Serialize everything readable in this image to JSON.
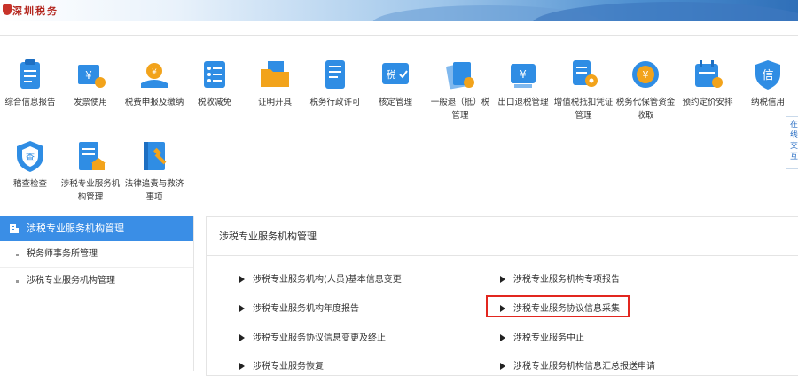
{
  "banner": {
    "logo_text": "深圳税务"
  },
  "tiles": [
    {
      "label": "综合信息报告",
      "icon": "report-icon",
      "color": "#2f8de4"
    },
    {
      "label": "发票使用",
      "icon": "invoice-icon",
      "color": "#2f8de4"
    },
    {
      "label": "税费申报及缴纳",
      "icon": "tax-declare-icon",
      "color": "#2f8de4"
    },
    {
      "label": "税收减免",
      "icon": "tax-relief-icon",
      "color": "#2f8de4"
    },
    {
      "label": "证明开具",
      "icon": "certificate-folder-icon",
      "color": "#f2a31b"
    },
    {
      "label": "税务行政许可",
      "icon": "license-doc-icon",
      "color": "#2f8de4"
    },
    {
      "label": "核定管理",
      "icon": "tax-check-icon",
      "color": "#2f8de4"
    },
    {
      "label": "一般退（抵）税管理",
      "icon": "refund-docs-icon",
      "color": "#2f8de4"
    },
    {
      "label": "出口退税管理",
      "icon": "export-refund-icon",
      "color": "#2f8de4"
    },
    {
      "label": "增值税抵扣凭证管理",
      "icon": "vat-gear-icon",
      "color": "#2f8de4"
    },
    {
      "label": "税务代保管资金收取",
      "icon": "coin-icon",
      "color": "#2f8de4"
    },
    {
      "label": "预约定价安排",
      "icon": "calendar-icon",
      "color": "#2f8de4"
    },
    {
      "label": "纳税信用",
      "icon": "credit-shield-icon",
      "color": "#2f8de4"
    },
    {
      "label": "稽查检查",
      "icon": "inspect-shield-icon",
      "color": "#2f8de4"
    },
    {
      "label": "涉税专业服务机构管理",
      "icon": "agency-building-icon",
      "color": "#2f8de4"
    },
    {
      "label": "法律追责与救济事项",
      "icon": "law-book-icon",
      "color": "#2f8de4"
    }
  ],
  "float_tab": "在线交互",
  "sidebar": {
    "title": "涉税专业服务机构管理",
    "items": [
      "税务师事务所管理",
      "涉税专业服务机构管理"
    ]
  },
  "panel": {
    "title": "涉税专业服务机构管理",
    "links": [
      "涉税专业服务机构(人员)基本信息变更",
      "涉税专业服务机构专项报告",
      "涉税专业服务机构年度报告",
      "涉税专业服务协议信息采集",
      "涉税专业服务协议信息变更及终止",
      "涉税专业服务中止",
      "涉税专业服务恢复",
      "涉税专业服务机构信息汇总报送申请"
    ],
    "highlighted_link": "涉税专业服务协议信息采集",
    "highlight_color": "#e2261f"
  }
}
